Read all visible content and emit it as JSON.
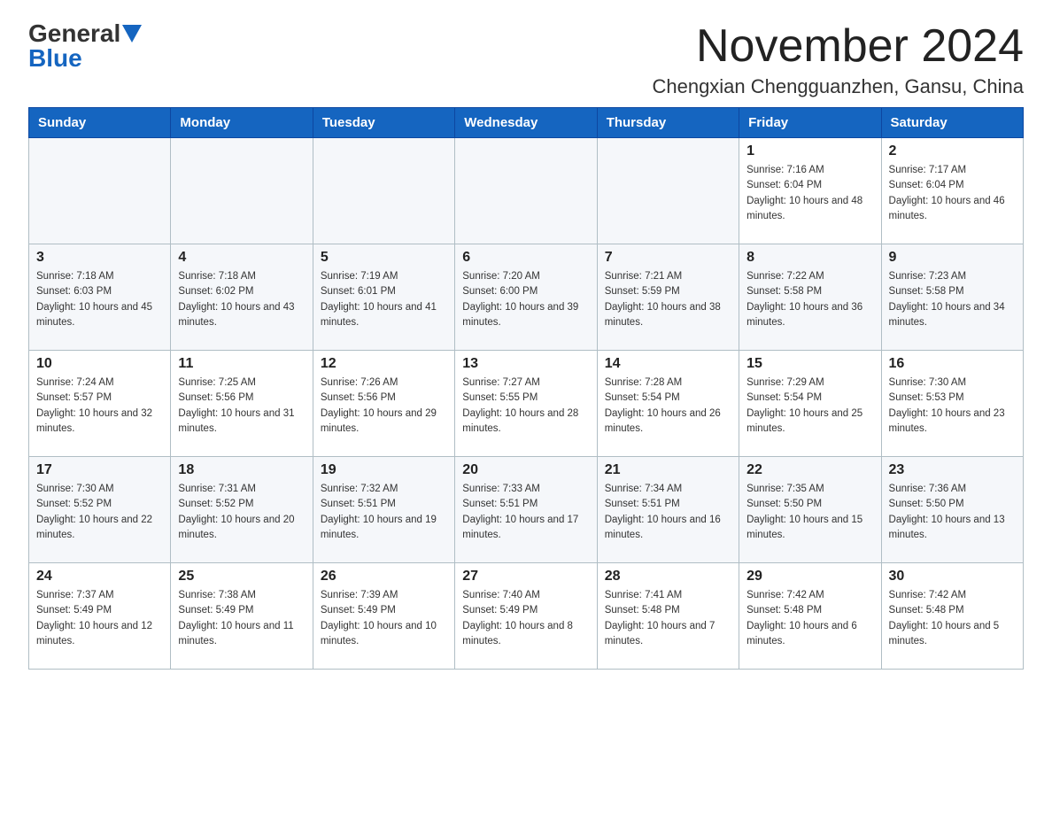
{
  "header": {
    "logo_general": "General",
    "logo_blue": "Blue",
    "month_title": "November 2024",
    "location": "Chengxian Chengguanzhen, Gansu, China"
  },
  "weekdays": [
    "Sunday",
    "Monday",
    "Tuesday",
    "Wednesday",
    "Thursday",
    "Friday",
    "Saturday"
  ],
  "weeks": [
    [
      {
        "day": "",
        "sunrise": "",
        "sunset": "",
        "daylight": ""
      },
      {
        "day": "",
        "sunrise": "",
        "sunset": "",
        "daylight": ""
      },
      {
        "day": "",
        "sunrise": "",
        "sunset": "",
        "daylight": ""
      },
      {
        "day": "",
        "sunrise": "",
        "sunset": "",
        "daylight": ""
      },
      {
        "day": "",
        "sunrise": "",
        "sunset": "",
        "daylight": ""
      },
      {
        "day": "1",
        "sunrise": "Sunrise: 7:16 AM",
        "sunset": "Sunset: 6:04 PM",
        "daylight": "Daylight: 10 hours and 48 minutes."
      },
      {
        "day": "2",
        "sunrise": "Sunrise: 7:17 AM",
        "sunset": "Sunset: 6:04 PM",
        "daylight": "Daylight: 10 hours and 46 minutes."
      }
    ],
    [
      {
        "day": "3",
        "sunrise": "Sunrise: 7:18 AM",
        "sunset": "Sunset: 6:03 PM",
        "daylight": "Daylight: 10 hours and 45 minutes."
      },
      {
        "day": "4",
        "sunrise": "Sunrise: 7:18 AM",
        "sunset": "Sunset: 6:02 PM",
        "daylight": "Daylight: 10 hours and 43 minutes."
      },
      {
        "day": "5",
        "sunrise": "Sunrise: 7:19 AM",
        "sunset": "Sunset: 6:01 PM",
        "daylight": "Daylight: 10 hours and 41 minutes."
      },
      {
        "day": "6",
        "sunrise": "Sunrise: 7:20 AM",
        "sunset": "Sunset: 6:00 PM",
        "daylight": "Daylight: 10 hours and 39 minutes."
      },
      {
        "day": "7",
        "sunrise": "Sunrise: 7:21 AM",
        "sunset": "Sunset: 5:59 PM",
        "daylight": "Daylight: 10 hours and 38 minutes."
      },
      {
        "day": "8",
        "sunrise": "Sunrise: 7:22 AM",
        "sunset": "Sunset: 5:58 PM",
        "daylight": "Daylight: 10 hours and 36 minutes."
      },
      {
        "day": "9",
        "sunrise": "Sunrise: 7:23 AM",
        "sunset": "Sunset: 5:58 PM",
        "daylight": "Daylight: 10 hours and 34 minutes."
      }
    ],
    [
      {
        "day": "10",
        "sunrise": "Sunrise: 7:24 AM",
        "sunset": "Sunset: 5:57 PM",
        "daylight": "Daylight: 10 hours and 32 minutes."
      },
      {
        "day": "11",
        "sunrise": "Sunrise: 7:25 AM",
        "sunset": "Sunset: 5:56 PM",
        "daylight": "Daylight: 10 hours and 31 minutes."
      },
      {
        "day": "12",
        "sunrise": "Sunrise: 7:26 AM",
        "sunset": "Sunset: 5:56 PM",
        "daylight": "Daylight: 10 hours and 29 minutes."
      },
      {
        "day": "13",
        "sunrise": "Sunrise: 7:27 AM",
        "sunset": "Sunset: 5:55 PM",
        "daylight": "Daylight: 10 hours and 28 minutes."
      },
      {
        "day": "14",
        "sunrise": "Sunrise: 7:28 AM",
        "sunset": "Sunset: 5:54 PM",
        "daylight": "Daylight: 10 hours and 26 minutes."
      },
      {
        "day": "15",
        "sunrise": "Sunrise: 7:29 AM",
        "sunset": "Sunset: 5:54 PM",
        "daylight": "Daylight: 10 hours and 25 minutes."
      },
      {
        "day": "16",
        "sunrise": "Sunrise: 7:30 AM",
        "sunset": "Sunset: 5:53 PM",
        "daylight": "Daylight: 10 hours and 23 minutes."
      }
    ],
    [
      {
        "day": "17",
        "sunrise": "Sunrise: 7:30 AM",
        "sunset": "Sunset: 5:52 PM",
        "daylight": "Daylight: 10 hours and 22 minutes."
      },
      {
        "day": "18",
        "sunrise": "Sunrise: 7:31 AM",
        "sunset": "Sunset: 5:52 PM",
        "daylight": "Daylight: 10 hours and 20 minutes."
      },
      {
        "day": "19",
        "sunrise": "Sunrise: 7:32 AM",
        "sunset": "Sunset: 5:51 PM",
        "daylight": "Daylight: 10 hours and 19 minutes."
      },
      {
        "day": "20",
        "sunrise": "Sunrise: 7:33 AM",
        "sunset": "Sunset: 5:51 PM",
        "daylight": "Daylight: 10 hours and 17 minutes."
      },
      {
        "day": "21",
        "sunrise": "Sunrise: 7:34 AM",
        "sunset": "Sunset: 5:51 PM",
        "daylight": "Daylight: 10 hours and 16 minutes."
      },
      {
        "day": "22",
        "sunrise": "Sunrise: 7:35 AM",
        "sunset": "Sunset: 5:50 PM",
        "daylight": "Daylight: 10 hours and 15 minutes."
      },
      {
        "day": "23",
        "sunrise": "Sunrise: 7:36 AM",
        "sunset": "Sunset: 5:50 PM",
        "daylight": "Daylight: 10 hours and 13 minutes."
      }
    ],
    [
      {
        "day": "24",
        "sunrise": "Sunrise: 7:37 AM",
        "sunset": "Sunset: 5:49 PM",
        "daylight": "Daylight: 10 hours and 12 minutes."
      },
      {
        "day": "25",
        "sunrise": "Sunrise: 7:38 AM",
        "sunset": "Sunset: 5:49 PM",
        "daylight": "Daylight: 10 hours and 11 minutes."
      },
      {
        "day": "26",
        "sunrise": "Sunrise: 7:39 AM",
        "sunset": "Sunset: 5:49 PM",
        "daylight": "Daylight: 10 hours and 10 minutes."
      },
      {
        "day": "27",
        "sunrise": "Sunrise: 7:40 AM",
        "sunset": "Sunset: 5:49 PM",
        "daylight": "Daylight: 10 hours and 8 minutes."
      },
      {
        "day": "28",
        "sunrise": "Sunrise: 7:41 AM",
        "sunset": "Sunset: 5:48 PM",
        "daylight": "Daylight: 10 hours and 7 minutes."
      },
      {
        "day": "29",
        "sunrise": "Sunrise: 7:42 AM",
        "sunset": "Sunset: 5:48 PM",
        "daylight": "Daylight: 10 hours and 6 minutes."
      },
      {
        "day": "30",
        "sunrise": "Sunrise: 7:42 AM",
        "sunset": "Sunset: 5:48 PM",
        "daylight": "Daylight: 10 hours and 5 minutes."
      }
    ]
  ]
}
